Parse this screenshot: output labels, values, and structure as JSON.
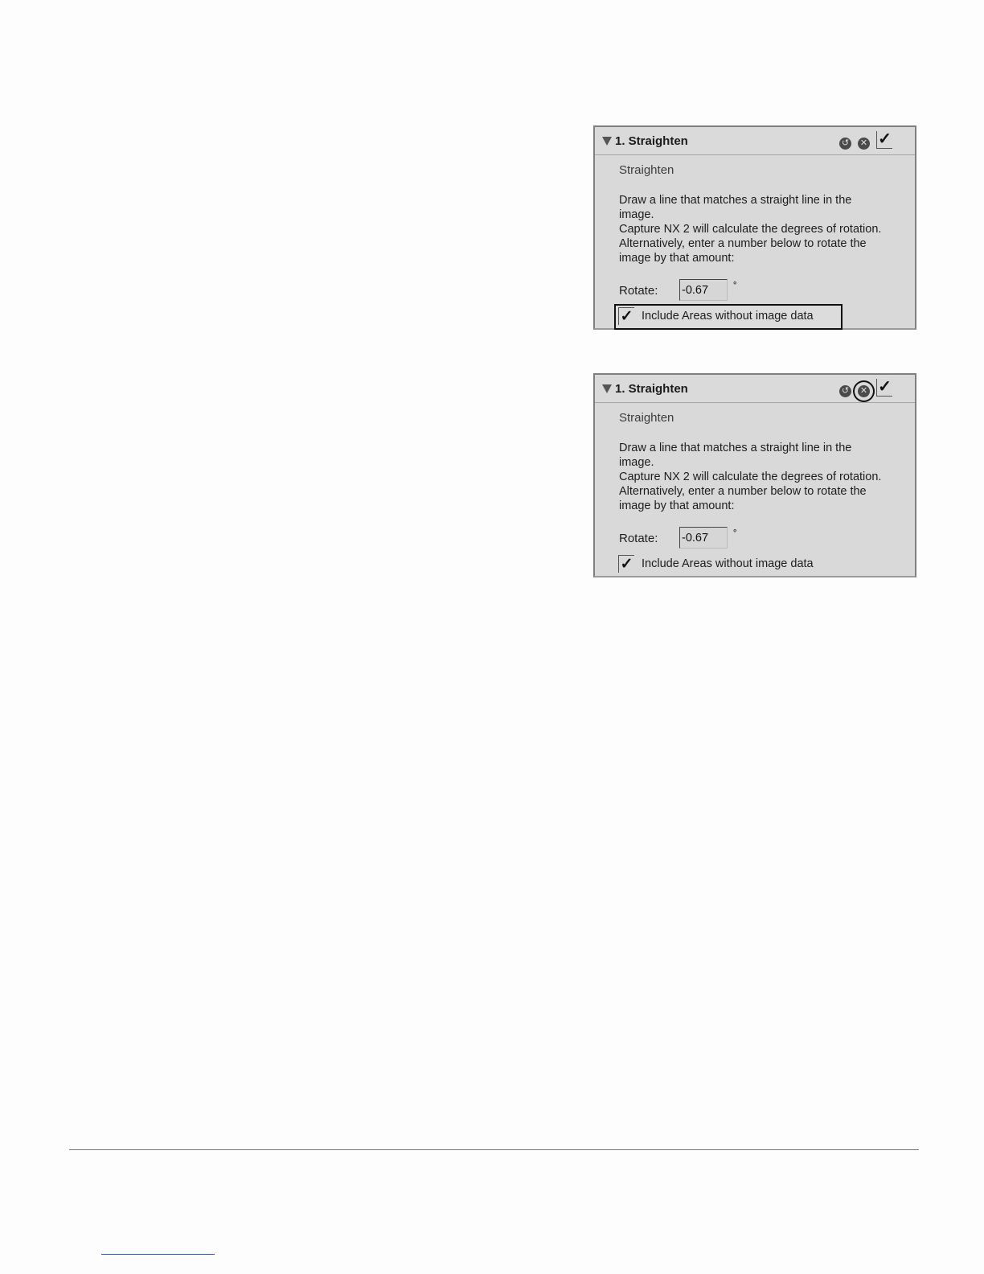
{
  "panels": [
    {
      "title": "1. Straighten",
      "subtitle": "Straighten",
      "description_lines": [
        "Draw a line that matches a straight line in the",
        "image.",
        "Capture NX 2 will calculate the degrees of rotation.",
        "Alternatively, enter a number below to rotate the",
        "image by that amount:"
      ],
      "rotate_label": "Rotate:",
      "rotate_value": "-0.67",
      "degree_symbol": "°",
      "include_areas_label": "Include Areas without image data",
      "include_areas_checked": true,
      "enabled": true,
      "highlighted": "include-areas-option"
    },
    {
      "title": "1. Straighten",
      "subtitle": "Straighten",
      "description_lines": [
        "Draw a line that matches a straight line in the",
        "image.",
        "Capture NX 2 will calculate the degrees of rotation.",
        "Alternatively, enter a number below to rotate the",
        "image by that amount:"
      ],
      "rotate_label": "Rotate:",
      "rotate_value": "-0.67",
      "degree_symbol": "°",
      "include_areas_label": "Include Areas without image data",
      "include_areas_checked": true,
      "enabled": true,
      "highlighted": "remove-step-icon"
    }
  ],
  "glyphs": {
    "check": "✓",
    "reset": "↺",
    "remove": "✕"
  },
  "icons": {
    "disclosure": "disclosure-triangle-icon",
    "reset": "reset-icon",
    "remove": "remove-icon",
    "enable": "checkmark-icon"
  },
  "colors": {
    "panel_background": "#d9d9d9",
    "panel_border": "#7f7f7f",
    "highlight_outline": "#111111",
    "footer_link_line": "#2a55c8"
  }
}
